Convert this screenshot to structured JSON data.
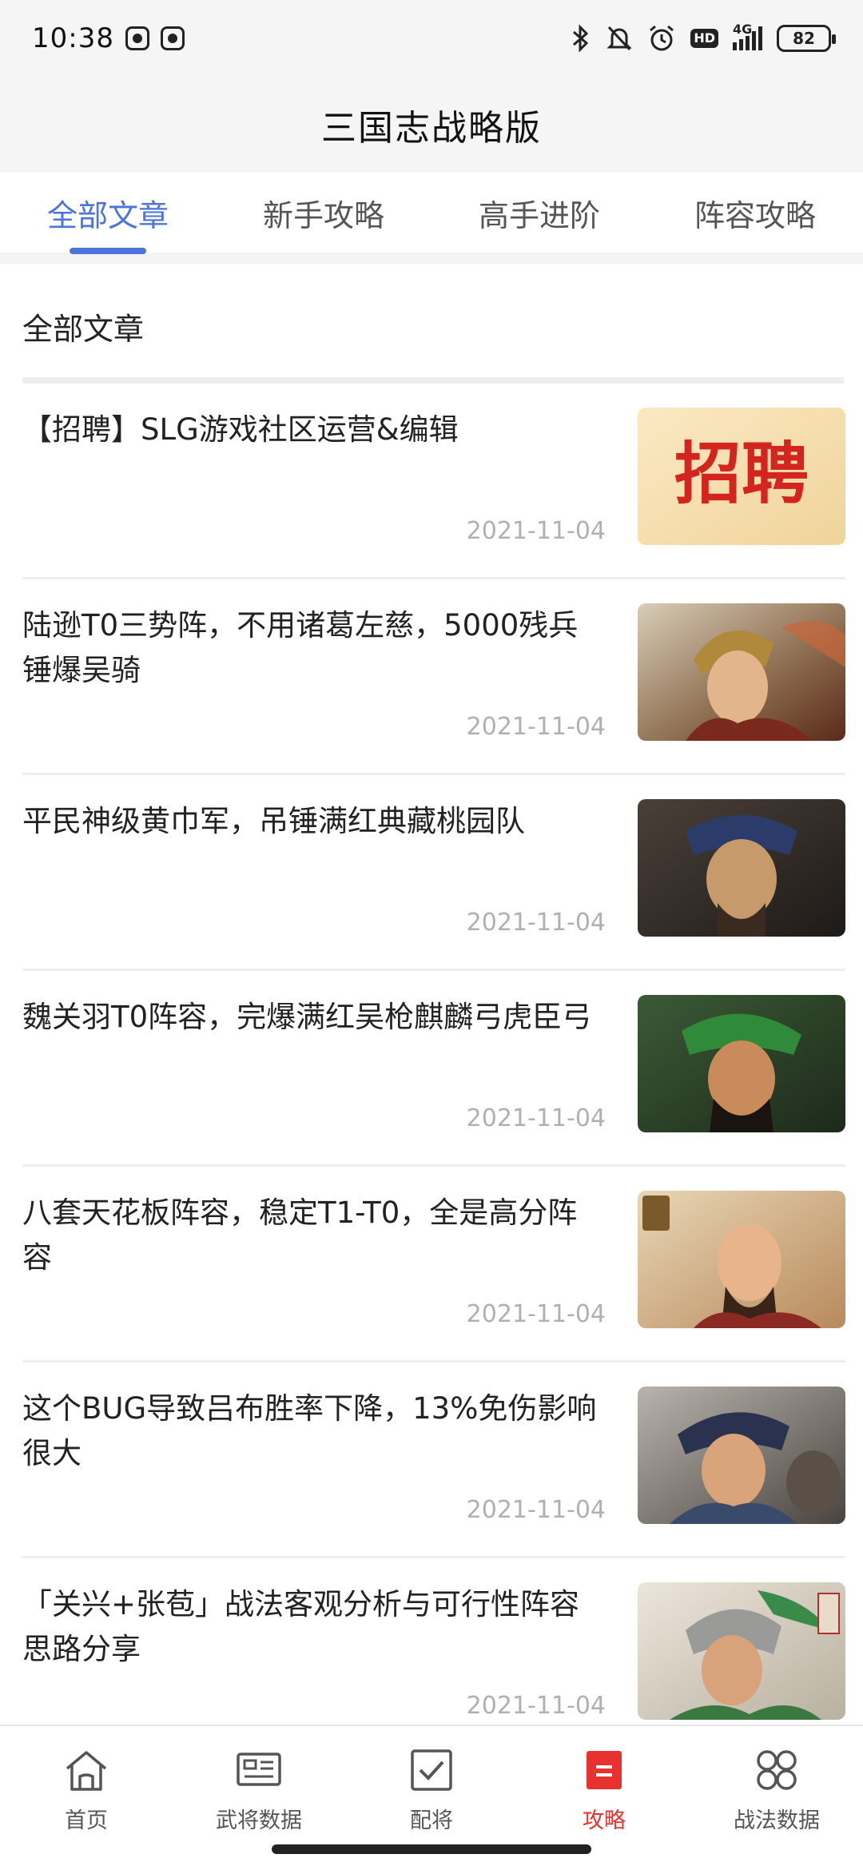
{
  "status_bar": {
    "time": "10:38",
    "network": "4G",
    "hd_label": "HD",
    "battery": "82",
    "icons": [
      "bluetooth-icon",
      "mute-bell-icon",
      "alarm-icon",
      "hd-icon",
      "signal-icon",
      "battery-icon"
    ]
  },
  "header": {
    "title": "三国志战略版"
  },
  "tabs": [
    {
      "label": "全部文章",
      "active": true
    },
    {
      "label": "新手攻略",
      "active": false
    },
    {
      "label": "高手进阶",
      "active": false
    },
    {
      "label": "阵容攻略",
      "active": false
    }
  ],
  "section": {
    "title": "全部文章"
  },
  "articles": [
    {
      "title": "【招聘】SLG游戏社区运营&编辑",
      "date": "2021-11-04",
      "thumb_text": "招聘"
    },
    {
      "title": "陆逊T0三势阵，不用诸葛左慈，5000残兵锤爆吴骑",
      "date": "2021-11-04"
    },
    {
      "title": "平民神级黄巾军，吊锤满红典藏桃园队",
      "date": "2021-11-04"
    },
    {
      "title": "魏关羽T0阵容，完爆满红吴枪麒麟弓虎臣弓",
      "date": "2021-11-04"
    },
    {
      "title": "八套天花板阵容，稳定T1-T0，全是高分阵容",
      "date": "2021-11-04"
    },
    {
      "title": "这个BUG导致吕布胜率下降，13%免伤影响很大",
      "date": "2021-11-04"
    },
    {
      "title": "「关兴+张苞」战法客观分析与可行性阵容思路分享",
      "date": "2021-11-04"
    }
  ],
  "bottom_nav": [
    {
      "label": "首页",
      "icon": "home-icon",
      "active": false
    },
    {
      "label": "武将数据",
      "icon": "general-card-icon",
      "active": false
    },
    {
      "label": "配将",
      "icon": "checkbox-icon",
      "active": false
    },
    {
      "label": "攻略",
      "icon": "guide-icon",
      "active": true
    },
    {
      "label": "战法数据",
      "icon": "tactics-grid-icon",
      "active": false
    }
  ],
  "colors": {
    "accent_blue": "#4a74d9",
    "accent_red": "#e8322f",
    "date_gray": "#b0b0b0"
  }
}
